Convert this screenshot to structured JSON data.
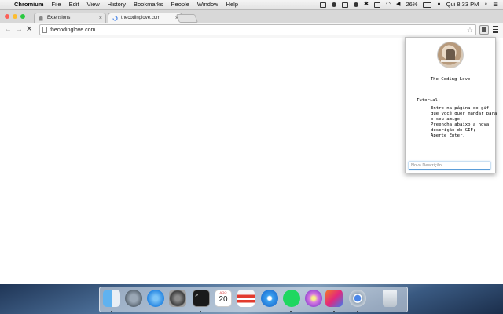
{
  "menubar": {
    "app_name": "Chromium",
    "menus": [
      "File",
      "Edit",
      "View",
      "History",
      "Bookmarks",
      "People",
      "Window",
      "Help"
    ],
    "battery": "26%",
    "clock": "Qui 8:33 PM"
  },
  "tabs": [
    {
      "label": "Extensions",
      "active": false
    },
    {
      "label": "thecodinglove.com",
      "active": true
    }
  ],
  "omnibox": {
    "url": "thecodinglove.com"
  },
  "popup": {
    "title": "The Coding Love",
    "tutorial_heading": "Tutorial:",
    "steps": [
      "Entre na página do gif que você quer mandar para o seu amigo;",
      "Preencha abaixo a nova descrição do GIF;",
      "Aperte Enter."
    ],
    "input_placeholder": "Nova Descrição"
  },
  "dock": {
    "calendar_month": "AGO",
    "calendar_day": "20",
    "apps": [
      "finder-icon",
      "launchpad-icon",
      "app-store-icon",
      "system-preferences-icon",
      "terminal-icon",
      "calendar-icon",
      "popcorn-icon",
      "safari-icon",
      "spotify-icon",
      "flower-icon",
      "intellij-icon",
      "chromium-icon",
      "trash-icon"
    ]
  }
}
